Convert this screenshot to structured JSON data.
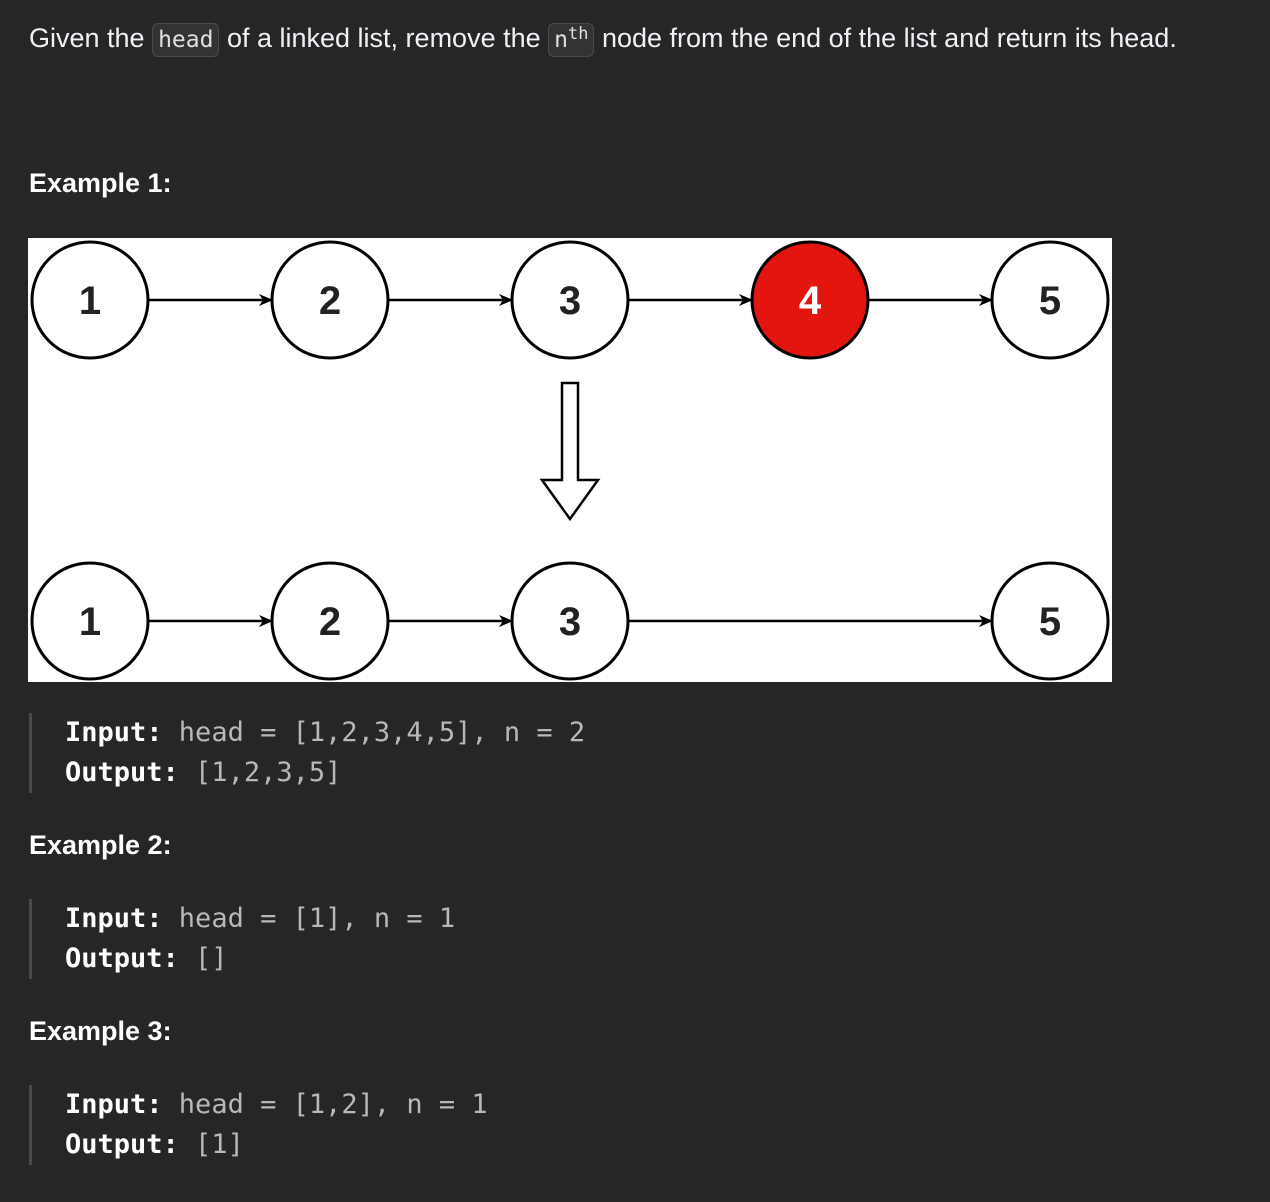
{
  "description": {
    "part1": "Given the ",
    "code_head": "head",
    "part2": " of a linked list, remove the ",
    "code_n": "n",
    "code_sup": "th",
    "part3": " node from the end of the list and return its head."
  },
  "examples": [
    {
      "heading": "Example 1:",
      "input_label": "Input:",
      "input_value": " head = [1,2,3,4,5], n = 2",
      "output_label": "Output:",
      "output_value": " [1,2,3,5]"
    },
    {
      "heading": "Example 2:",
      "input_label": "Input:",
      "input_value": " head = [1], n = 1",
      "output_label": "Output:",
      "output_value": " []"
    },
    {
      "heading": "Example 3:",
      "input_label": "Input:",
      "input_value": " head = [1,2], n = 1",
      "output_label": "Output:",
      "output_value": " [1]"
    }
  ],
  "diagram": {
    "before_nodes": [
      "1",
      "2",
      "3",
      "4",
      "5"
    ],
    "removed_node": "4",
    "after_nodes": [
      "1",
      "2",
      "3",
      "5"
    ],
    "colors": {
      "removed_fill": "#e3150f",
      "node_fill": "#ffffff",
      "stroke": "#000000"
    }
  }
}
